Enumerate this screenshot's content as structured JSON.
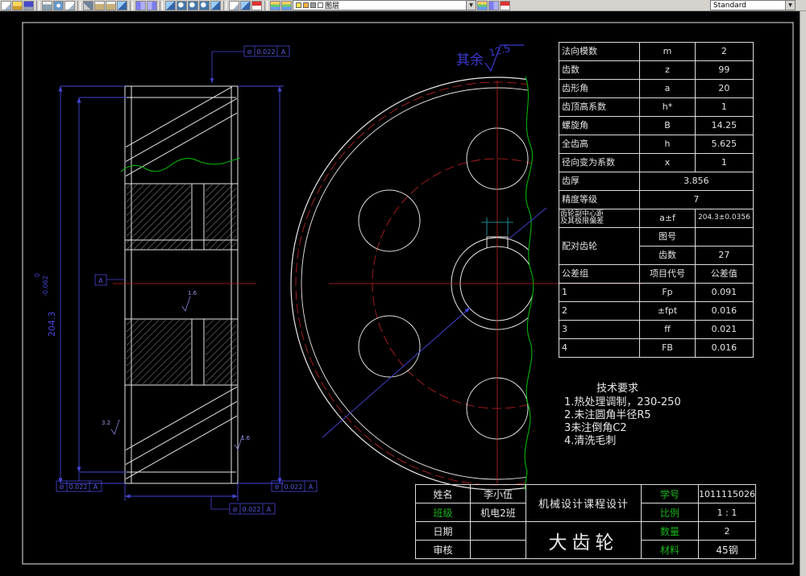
{
  "toolbar": {
    "layer_combo_label": "图层",
    "style_combo_label": "Standard"
  },
  "drawing": {
    "surface_prefix": "其余",
    "surface_value": "12.5",
    "dim_outer": "204.3",
    "dim_tol_upper": "0",
    "dim_tol_lower": "-0.062",
    "finish_bore": "1.6",
    "finish_side": "1.6",
    "finish_face": "3.2",
    "gdt": {
      "symbol": "⊘",
      "value": "0.022",
      "datum": "A"
    }
  },
  "param_table": {
    "rows": [
      {
        "name": "法向模数",
        "sym": "m",
        "val": "2"
      },
      {
        "name": "齿数",
        "sym": "z",
        "val": "99"
      },
      {
        "name": "齿形角",
        "sym": "a",
        "val": "20"
      },
      {
        "name": "齿顶高系数",
        "sym": "h*",
        "val": "1"
      },
      {
        "name": "螺旋角",
        "sym": "B",
        "val": "14.25"
      },
      {
        "name": "全齿高",
        "sym": "h",
        "val": "5.625"
      },
      {
        "name": "径向变为系数",
        "sym": "x",
        "val": "1"
      }
    ],
    "thickness_label": "齿厚",
    "thickness_val": "3.856",
    "precision_label": "精度等级",
    "precision_val": "7",
    "center_dist_label1": "齿轮副中心距",
    "center_dist_label2": "及其极限偏差",
    "center_dist_sym": "a±f",
    "center_dist_val": "204.3±0.0356",
    "mate_label": "配对齿轮",
    "mate_r1": "图号",
    "mate_r1_val": "",
    "mate_r2": "齿数",
    "mate_r2_val": "27",
    "tol_group_label": "公差组",
    "tol_item_label": "项目代号",
    "tol_value_label": "公差值",
    "tol_rows": [
      {
        "g": "1",
        "item": "Fp",
        "val": "0.091"
      },
      {
        "g": "2",
        "item": "±fpt",
        "val": "0.016"
      },
      {
        "g": "3",
        "item": "ff",
        "val": "0.021"
      },
      {
        "g": "4",
        "item": "FB",
        "val": "0.016"
      }
    ]
  },
  "tech_req": {
    "title": "技术要求",
    "lines": [
      "1.热处理调制，230-250",
      "2.未注圆角半径R5",
      "3未注倒角C2",
      "4.清洗毛刺"
    ]
  },
  "title_block": {
    "name_label": "姓名",
    "name": "李小伍",
    "class_label": "班级",
    "class": "机电2班",
    "date_label": "日期",
    "date": "",
    "check_label": "审核",
    "check": "",
    "course": "机械设计课程设计",
    "part": "大齿轮",
    "sid_label": "学号",
    "sid": "1011115026",
    "scale_label": "比例",
    "scale": "1 : 1",
    "qty_label": "数量",
    "qty": "2",
    "mat_label": "材料",
    "mat": "45钢"
  }
}
